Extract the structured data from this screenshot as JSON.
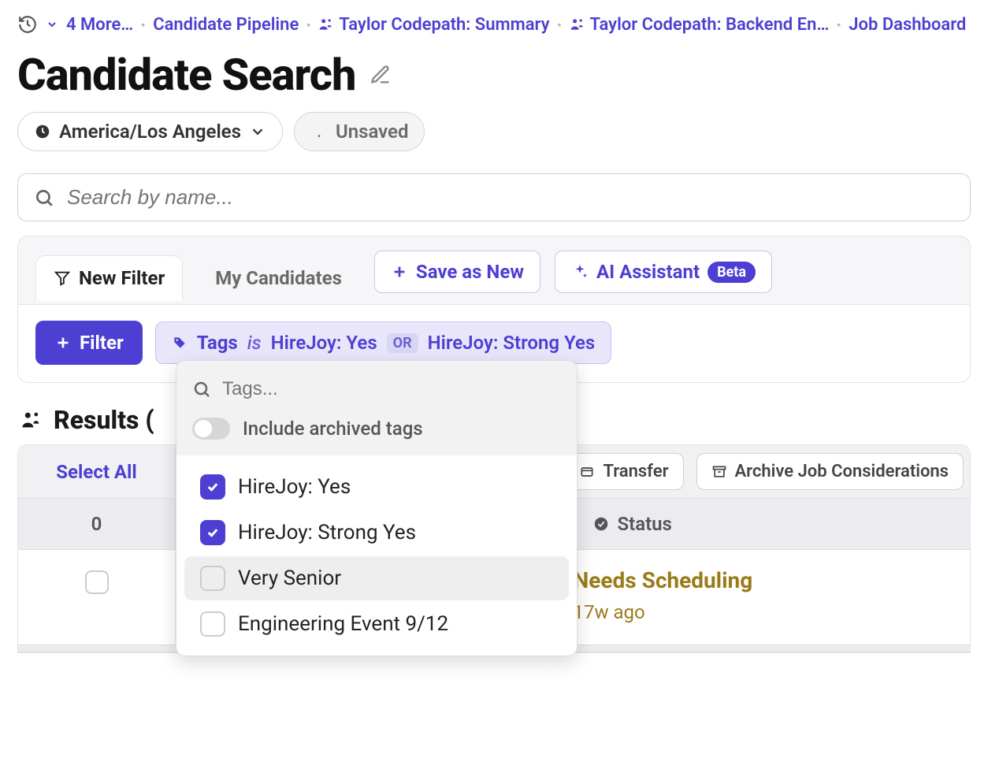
{
  "breadcrumbs": {
    "more_label": "4 More…",
    "items": [
      "Candidate Pipeline",
      "Taylor Codepath: Summary",
      "Taylor Codepath: Backend En…",
      "Job Dashboard"
    ]
  },
  "title": "Candidate Search",
  "timezone": "America/Los Angeles",
  "unsaved_label": "Unsaved",
  "search": {
    "placeholder": "Search by name..."
  },
  "tabs": {
    "new_filter": "New Filter",
    "my_candidates": "My Candidates",
    "save_as_new": "Save as New",
    "ai_assistant": "AI Assistant",
    "beta": "Beta"
  },
  "filter_button": "Filter",
  "tag_filter": {
    "label": "Tags",
    "op": "is",
    "value1": "HireJoy: Yes",
    "or": "OR",
    "value2": "HireJoy: Strong Yes"
  },
  "dropdown": {
    "search_placeholder": "Tags...",
    "toggle_label": "Include archived tags",
    "options": [
      {
        "label": "HireJoy: Yes",
        "checked": true,
        "hover": false
      },
      {
        "label": "HireJoy: Strong Yes",
        "checked": true,
        "hover": false
      },
      {
        "label": "Very Senior",
        "checked": false,
        "hover": true
      },
      {
        "label": "Engineering Event 9/12",
        "checked": false,
        "hover": false
      }
    ]
  },
  "results": {
    "header": "Results (",
    "select_all": "Select All",
    "count_header": "0",
    "transfer": "Transfer",
    "archive": "Archive Job Considerations",
    "status_header": "Status",
    "row": {
      "status": "Needs Scheduling",
      "time": "17w ago"
    }
  }
}
